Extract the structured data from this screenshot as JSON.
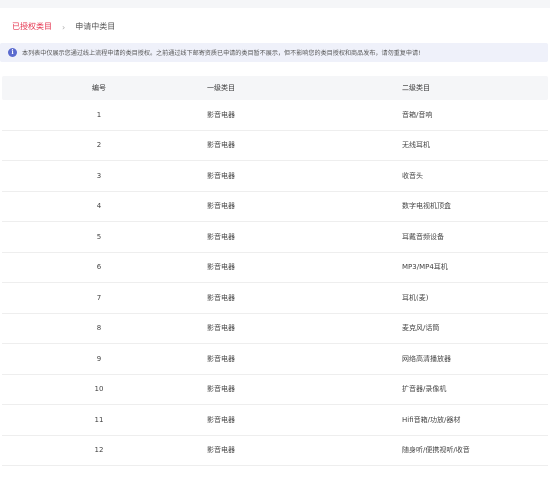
{
  "tabs": [
    {
      "label": "已授权类目",
      "active": true
    },
    {
      "label": "申请中类目",
      "active": false
    }
  ],
  "tab_separator": "›",
  "notice": {
    "icon": "info-icon",
    "icon_glyph": "i",
    "text": "本列表中仅展示您通过线上流程申请的类目授权。之前通过线下邮寄资质已申请的类目暂不展示，但不影响您的类目授权和商品发布，请勿重复申请!"
  },
  "table": {
    "headers": [
      "编号",
      "一级类目",
      "二级类目"
    ],
    "rows": [
      {
        "id": "1",
        "level1": "影音电器",
        "level2": "音箱/音响"
      },
      {
        "id": "2",
        "level1": "影音电器",
        "level2": "无线耳机"
      },
      {
        "id": "3",
        "level1": "影音电器",
        "level2": "收音头"
      },
      {
        "id": "4",
        "level1": "影音电器",
        "level2": "数字电视机顶盒"
      },
      {
        "id": "5",
        "level1": "影音电器",
        "level2": "耳戴音频设备"
      },
      {
        "id": "6",
        "level1": "影音电器",
        "level2": "MP3/MP4耳机"
      },
      {
        "id": "7",
        "level1": "影音电器",
        "level2": "耳机(麦)"
      },
      {
        "id": "8",
        "level1": "影音电器",
        "level2": "麦克风/话筒"
      },
      {
        "id": "9",
        "level1": "影音电器",
        "level2": "网络高清播放器"
      },
      {
        "id": "10",
        "level1": "影音电器",
        "level2": "扩音器/录像机"
      },
      {
        "id": "11",
        "level1": "影音电器",
        "level2": "Hifi音箱/功放/器材"
      },
      {
        "id": "12",
        "level1": "影音电器",
        "level2": "随身听/便携视听/收音"
      }
    ]
  },
  "colors": {
    "accent": "#e5344f",
    "notice_bg": "#eff1fa",
    "info_icon": "#5b6bcf",
    "header_bg": "#f5f6f8"
  }
}
